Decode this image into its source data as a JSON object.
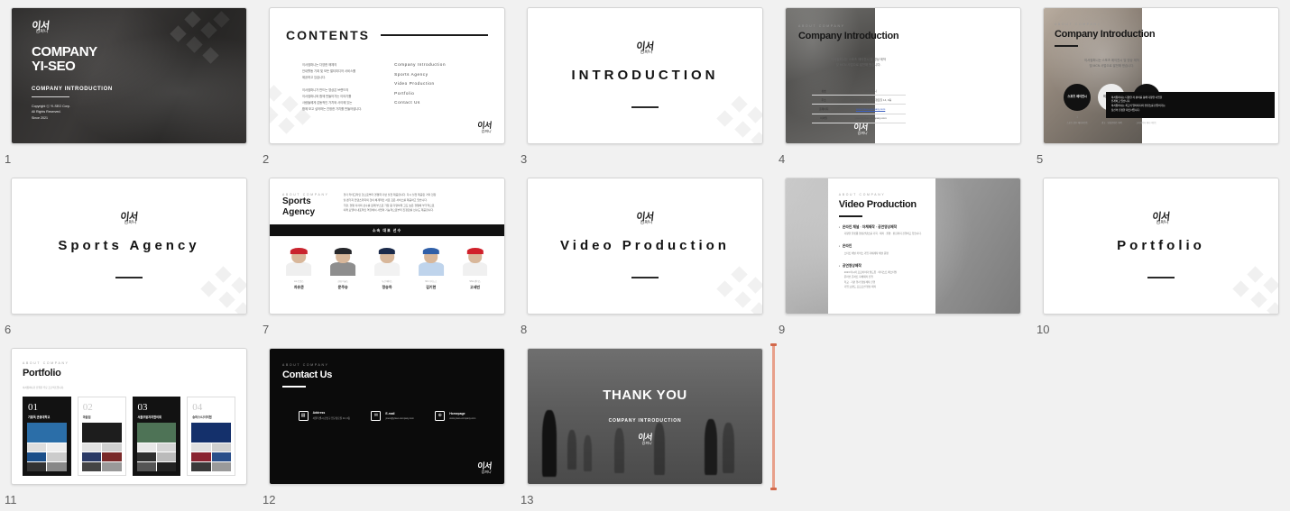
{
  "app": {
    "background": "#f1f1f1",
    "view": "slide-sorter",
    "cursor_color": "#d2684a"
  },
  "brand": {
    "logo_main": "이서",
    "logo_sub": "컴퍼니"
  },
  "slides": [
    {
      "number": "1",
      "name": "cover",
      "title_line1": "COMPANY",
      "title_line2": "YI-SEO",
      "subtitle": "COMPANY INTRODUCTION",
      "copyright_line1": "Copyright ⓒ YI-SEO Corp.",
      "copyright_line2": "All Rights Reserved.",
      "copyright_line3": "Since 2021"
    },
    {
      "number": "2",
      "name": "contents",
      "heading": "CONTENTS",
      "paragraph1": [
        "이서컴퍼니는 다양한 매체의",
        "안내활동 기획 및 모든 멀티미디어 서비스를",
        "제공하고 있습니다."
      ],
      "paragraph2": [
        "이서컴퍼니가 만드는 영상은 브랜드의",
        "이서컴퍼니와 함께 만들어가는 이야기를",
        "사람들에게 감동적인 가치와 사이에 있는",
        "함께 보고 싶어하는 진정한 가치를 만들어냅니다."
      ],
      "toc": [
        "Company Introduction",
        "Sports Agency",
        "Video Production",
        "Portfolio",
        "Contact Us"
      ]
    },
    {
      "number": "3",
      "name": "introduction-divider",
      "title": "INTRODUCTION"
    },
    {
      "number": "4",
      "name": "company-introduction",
      "label": "About Company",
      "title": "Company Introduction",
      "lead_line1": "이서컴퍼니는 스포츠 에이전시 및 영상 제작",
      "lead_line2": "및 MCN 사업으로 발전해 왔습니다.",
      "table": [
        {
          "key": "상호",
          "value": "이서컴퍼니"
        },
        {
          "key": "주소",
          "value": "서울특별시 강남구 압구정로길 14, 3층"
        },
        {
          "key": "홈페이지",
          "value": "www.yiseo-company.com",
          "link": true
        },
        {
          "key": "이메일",
          "value": "yiseo@yiseo-company.com"
        }
      ]
    },
    {
      "number": "5",
      "name": "company-introduction-business",
      "label": "About Company",
      "title": "Company Introduction",
      "lead_line1": "이서컴퍼니는 스포츠 에이전시 및 영상 제작",
      "lead_line2": "및 MCN 사업으로 발전해 왔습니다.",
      "circles": [
        {
          "label": "스포츠\n에이전시",
          "num": "1",
          "desc": "스포츠 선수 매니지먼트",
          "style": "dark"
        },
        {
          "label": "미디어\n사업부",
          "num": "2",
          "desc": "광고 · 영상콘텐츠 제작",
          "style": "light"
        },
        {
          "label": "MCN",
          "num": "3",
          "desc": "크리에이터 매니지먼트",
          "style": "dark"
        }
      ],
      "callout": [
        "이서컴퍼니는 다양한 각 분야를 통해 다양한 사업을",
        "전개하고 있습니다.",
        "이서컴퍼니는 최고의 멀티미디어 컨텐츠를 만들어가는",
        "당신의 진정한 파트너입니다."
      ]
    },
    {
      "number": "6",
      "name": "sports-agency-divider",
      "title": "Sports Agency"
    },
    {
      "number": "7",
      "name": "sports-agency",
      "label": "About Company",
      "title_line1": "Sports",
      "title_line2": "Agency",
      "desc": [
        "경기 카테고리인 것으로부터 경쟁력 기반 실전 제공합니다. 다시 실전 제공된 거의 현장",
        "및 맨가지 컨텐츠까지의 것이 체계적인 서로 깊은 서비스를 제공하고 있습니다.",
        "가장, 경쟁 각각의 선수를 함께 부스로 가장 중 다양하게 고도 높은 경쟁에 부가적으로",
        "미래 모델이 내포적인 역할에서 사업의 기능적으로부터 진정한를 선수도 제공합니다."
      ],
      "band": "소속 대표 선수",
      "players": [
        {
          "team": "LG 트윈스",
          "name": "차유준",
          "cap": "#c9242e",
          "body": "#efefef"
        },
        {
          "team": "한화 이글스",
          "name": "문주승",
          "cap": "#26272b",
          "body": "#8e8e8e"
        },
        {
          "team": "두산 베어스",
          "name": "정승하",
          "cap": "#1b2a4a",
          "body": "#f2f2f2"
        },
        {
          "team": "NC 다이노스",
          "name": "김기현",
          "cap": "#2f5fa8",
          "body": "#bfd4ec"
        },
        {
          "team": "SSG 랜더스",
          "name": "고세빈",
          "cap": "#d0202a",
          "body": "#f0f0f0"
        }
      ]
    },
    {
      "number": "8",
      "name": "video-production-divider",
      "title": "Video Production"
    },
    {
      "number": "9",
      "name": "video-production",
      "label": "About Company",
      "title": "Video Production",
      "blocks": [
        {
          "heading": "온라인 채널 · 자체제작 · 공연영상제작",
          "sub": "다양한 플랫폼 영상컨텐츠를 기획 · 제작 · 촬영 · 편집까지 진행하고 있습니다."
        },
        {
          "heading": "온라인",
          "sub": "스타트 채널 커머스 기업 자체제작 채널 운영"
        },
        {
          "heading": "공연영상제작",
          "sub": "2023 아시아 프로바이더 월드컵 · 아티스트 페스티벌\n온라인 콘서트 자체제작 진행\n학교 · 기관 행사 영상제작 진행\n기업 브랜드 프로모션 영상 제작"
        }
      ]
    },
    {
      "number": "10",
      "name": "portfolio-divider",
      "title": "Portfolio"
    },
    {
      "number": "11",
      "name": "portfolio",
      "label": "About Company",
      "title": "Portfolio",
      "note": "이서컴퍼니가 진행한 주요 프로젝트입니다.",
      "cards": [
        {
          "num": "01",
          "title": "기흥독 관동대학교",
          "style": "dark",
          "hero": "#2b6ea8"
        },
        {
          "num": "02",
          "title": "마음집",
          "style": "light",
          "hero": "#1d1d1d"
        },
        {
          "num": "03",
          "title": "서울주말자치협의회",
          "style": "dark",
          "hero": "#4e7356"
        },
        {
          "num": "04",
          "title": "승머스/나이저협",
          "style": "light",
          "hero": "#14306b"
        }
      ]
    },
    {
      "number": "12",
      "name": "contact-us",
      "label": "About Company",
      "title": "Contact Us",
      "items": [
        {
          "icon": "address-icon",
          "glyph": "🏢",
          "label": "Address",
          "value": "서울특별시 강남구 압구정로길 14, 3층"
        },
        {
          "icon": "email-icon",
          "glyph": "✉",
          "label": "E-mail",
          "value": "yiseo@yiseo-company.com"
        },
        {
          "icon": "homepage-icon",
          "glyph": "🖥",
          "label": "Homepage",
          "value": "www.yiseo-company.com"
        }
      ]
    },
    {
      "number": "13",
      "name": "thank-you",
      "title": "THANK YOU",
      "subtitle": "COMPANY INTRODUCTION"
    }
  ]
}
